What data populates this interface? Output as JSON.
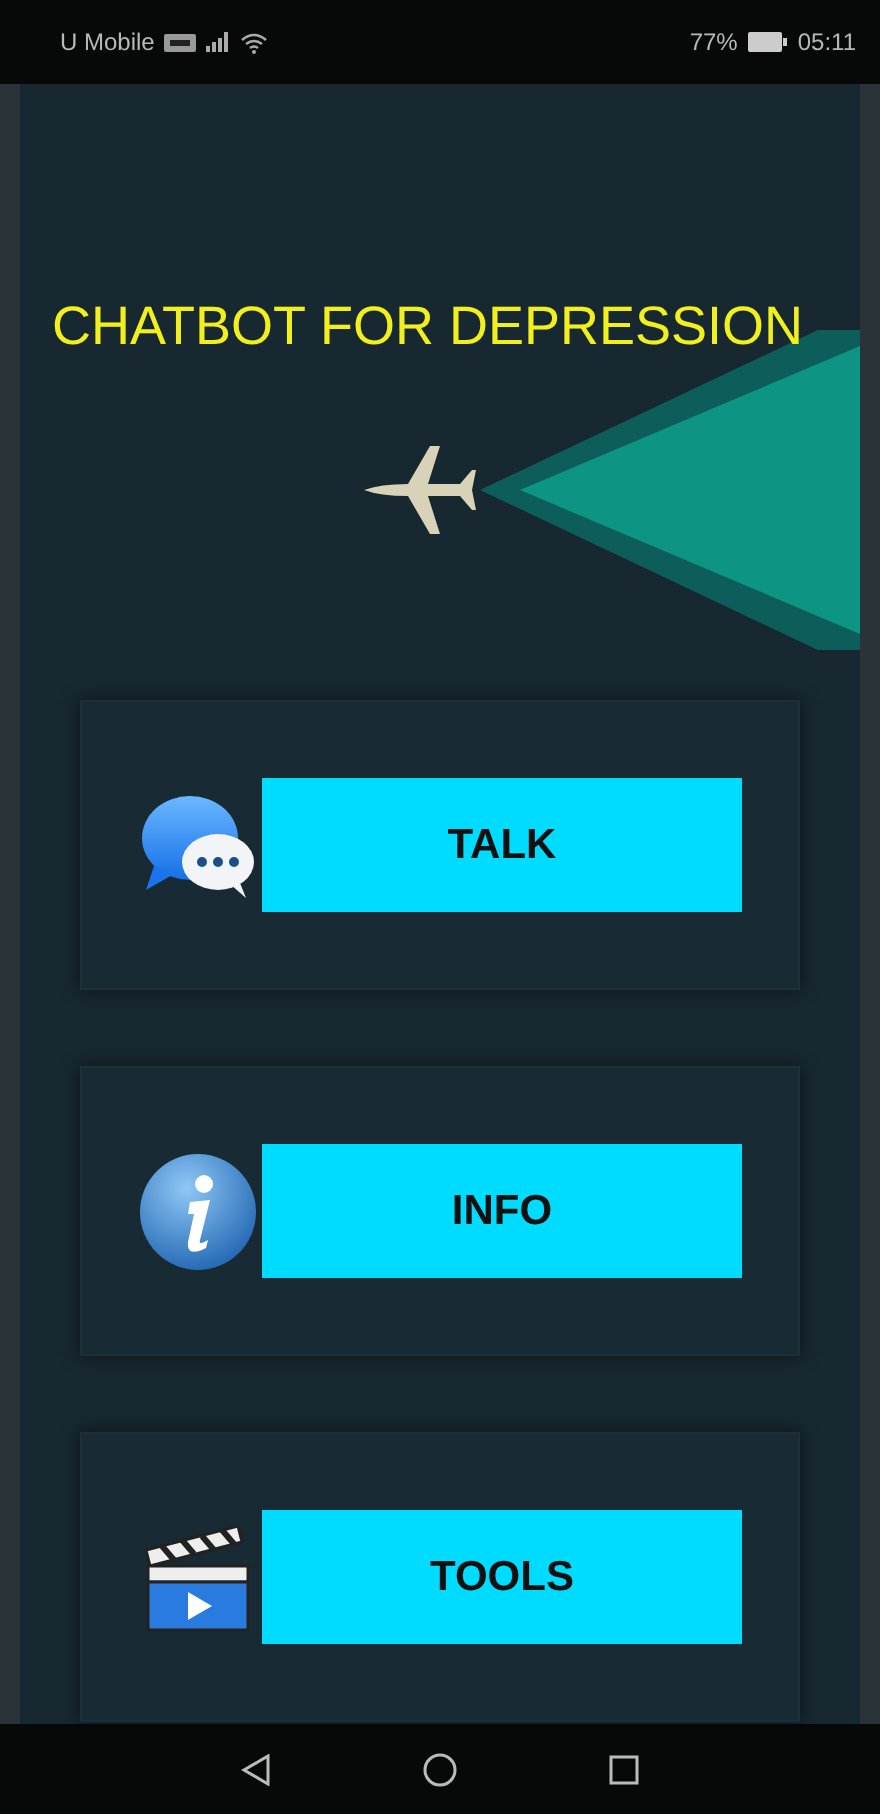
{
  "status_bar": {
    "carrier": "U Mobile",
    "battery_percent": "77%",
    "time": "05:11"
  },
  "title": "CHATBOT FOR DEPRESSION",
  "menu": [
    {
      "kind": "chat",
      "label": "TALK"
    },
    {
      "kind": "info",
      "label": "INFO"
    },
    {
      "kind": "video",
      "label": "TOOLS"
    }
  ]
}
